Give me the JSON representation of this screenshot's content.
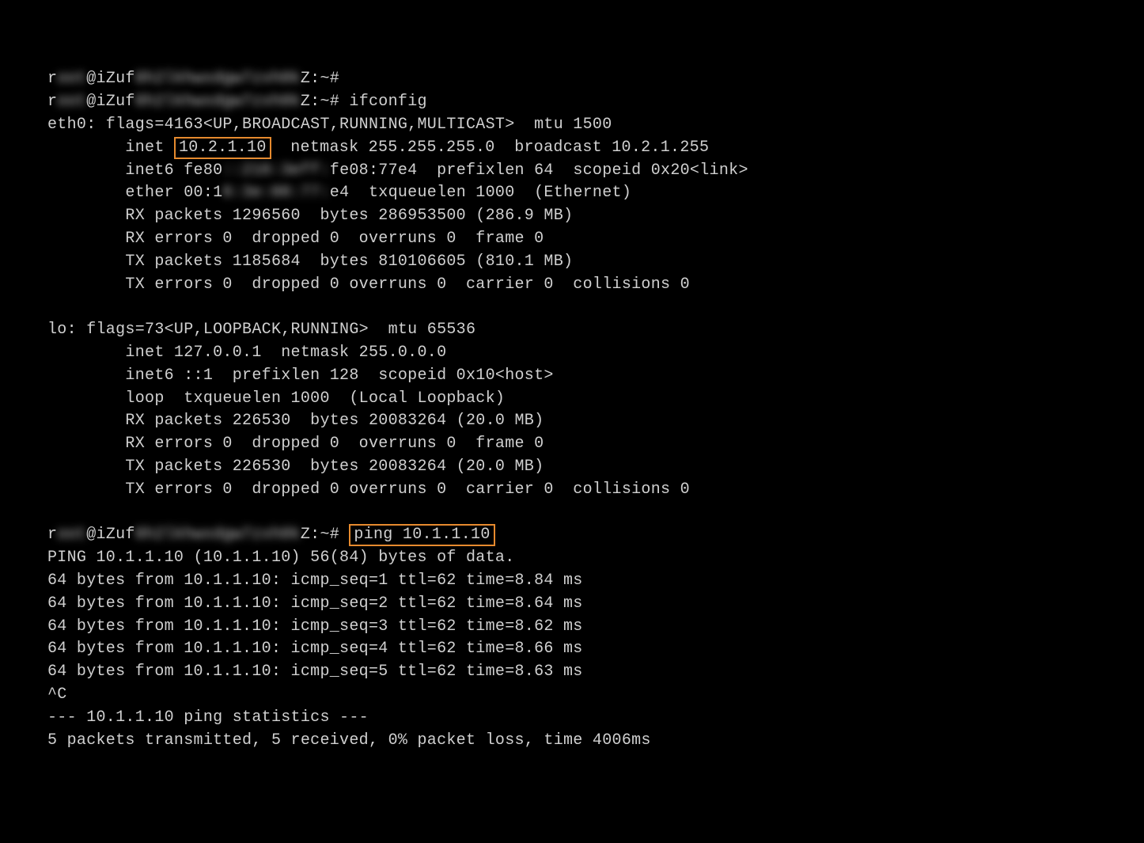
{
  "prompt_user_prefix": "r",
  "prompt_user_blur": "oot",
  "prompt_at": "@iZuf",
  "prompt_host_blur": "6h2lkhwxdgw7zxh0k",
  "prompt_suffix": "Z:~# ",
  "cmd_ifconfig": "ifconfig",
  "eth0_flags": "eth0: flags=4163<UP,BROADCAST,RUNNING,MULTICAST>  mtu 1500",
  "eth0_inet_pre": "        inet ",
  "eth0_ip_hl": "10.2.1.10",
  "eth0_inet_post": "  netmask 255.255.255.0  broadcast 10.2.1.255",
  "eth0_inet6_pre": "        inet6 fe80",
  "eth0_inet6_blur": "::216:3eff:",
  "eth0_inet6_post": "fe08:77e4  prefixlen 64  scopeid 0x20<link>",
  "eth0_ether_pre": "        ether 00:1",
  "eth0_ether_blur": "6:3e:08:77:",
  "eth0_ether_post": "e4  txqueuelen 1000  (Ethernet)",
  "eth0_rx_packets": "        RX packets 1296560  bytes 286953500 (286.9 MB)",
  "eth0_rx_errors": "        RX errors 0  dropped 0  overruns 0  frame 0",
  "eth0_tx_packets": "        TX packets 1185684  bytes 810106605 (810.1 MB)",
  "eth0_tx_errors": "        TX errors 0  dropped 0 overruns 0  carrier 0  collisions 0",
  "lo_flags": "lo: flags=73<UP,LOOPBACK,RUNNING>  mtu 65536",
  "lo_inet": "        inet 127.0.0.1  netmask 255.0.0.0",
  "lo_inet6": "        inet6 ::1  prefixlen 128  scopeid 0x10<host>",
  "lo_loop": "        loop  txqueuelen 1000  (Local Loopback)",
  "lo_rx_packets": "        RX packets 226530  bytes 20083264 (20.0 MB)",
  "lo_rx_errors": "        RX errors 0  dropped 0  overruns 0  frame 0",
  "lo_tx_packets": "        TX packets 226530  bytes 20083264 (20.0 MB)",
  "lo_tx_errors": "        TX errors 0  dropped 0 overruns 0  carrier 0  collisions 0",
  "cmd_ping_hl": "ping 10.1.1.10",
  "ping_header": "PING 10.1.1.10 (10.1.1.10) 56(84) bytes of data.",
  "ping_replies": [
    "64 bytes from 10.1.1.10: icmp_seq=1 ttl=62 time=8.84 ms",
    "64 bytes from 10.1.1.10: icmp_seq=2 ttl=62 time=8.64 ms",
    "64 bytes from 10.1.1.10: icmp_seq=3 ttl=62 time=8.62 ms",
    "64 bytes from 10.1.1.10: icmp_seq=4 ttl=62 time=8.66 ms",
    "64 bytes from 10.1.1.10: icmp_seq=5 ttl=62 time=8.63 ms"
  ],
  "ping_interrupt": "^C",
  "ping_stats_hdr": "--- 10.1.1.10 ping statistics ---",
  "ping_stats_line": "5 packets transmitted, 5 received, 0% packet loss, time 4006ms"
}
